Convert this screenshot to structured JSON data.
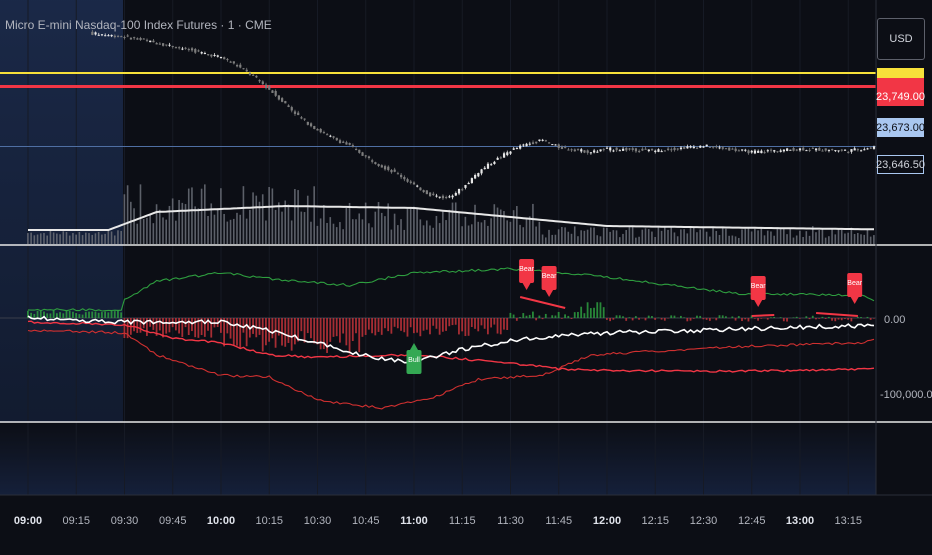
{
  "header": {
    "symbol_title": "Micro E-mini Nasdaq-100 Index Futures · 1 · CME",
    "currency": "USD"
  },
  "colors": {
    "background": "#0c0e15",
    "session_shade": "#16213a",
    "yellow_line": "#f7e13a",
    "red_line": "#f23645",
    "blue_line": "#4f6fa3",
    "candle_up": "#e6e6e6",
    "candle_down": "#7d7d7d",
    "volume_ma": "#e8e8e8",
    "upper_band": "#2e9e3f",
    "lower_band": "#d03030",
    "main_line": "#ffffff",
    "signal_line": "#f23645",
    "hist_pos": "#2e9e3f",
    "hist_neg": "#c2323a",
    "bull_label": "#34a853",
    "bear_label": "#f23645",
    "separator": "#e8e8e8"
  },
  "chart_data": [
    {
      "type": "line",
      "name": "price",
      "price_levels": [
        {
          "value": null,
          "color": "yellow",
          "label": ""
        },
        {
          "value": 23749.0,
          "label": "23,749.00",
          "color": "red"
        },
        {
          "value": 23673.0,
          "label": "23,673.00",
          "color": "blue"
        },
        {
          "value": 23646.5,
          "label": "23,646.50",
          "color": "dark"
        }
      ],
      "x_axis_ticks": [
        {
          "label": "09:00",
          "major": true
        },
        {
          "label": "09:15",
          "major": false
        },
        {
          "label": "09:30",
          "major": false
        },
        {
          "label": "09:45",
          "major": false
        },
        {
          "label": "10:00",
          "major": true
        },
        {
          "label": "10:15",
          "major": false
        },
        {
          "label": "10:30",
          "major": false
        },
        {
          "label": "10:45",
          "major": false
        },
        {
          "label": "11:00",
          "major": true
        },
        {
          "label": "11:15",
          "major": false
        },
        {
          "label": "11:30",
          "major": false
        },
        {
          "label": "11:45",
          "major": false
        },
        {
          "label": "12:00",
          "major": true
        },
        {
          "label": "12:15",
          "major": false
        },
        {
          "label": "12:30",
          "major": false
        },
        {
          "label": "12:45",
          "major": false
        },
        {
          "label": "13:00",
          "major": true
        },
        {
          "label": "13:15",
          "major": false
        }
      ],
      "series": [
        {
          "x": [
            "09:00",
            "09:15",
            "09:30",
            "09:45",
            "10:00",
            "10:05",
            "10:10",
            "10:15",
            "10:20",
            "10:25",
            "10:30",
            "10:35",
            "10:40",
            "10:45",
            "10:50",
            "10:55",
            "11:00",
            "11:05",
            "11:10",
            "11:15",
            "11:20",
            "11:25",
            "11:30",
            "11:35",
            "11:40",
            "11:45",
            "11:50",
            "11:55",
            "12:00",
            "12:15",
            "12:30",
            "12:45",
            "13:00",
            "13:15",
            "13:25"
          ],
          "y": [
            23815,
            23818,
            23812,
            23800,
            23786,
            23775,
            23762,
            23745,
            23727,
            23708,
            23694,
            23683,
            23674,
            23660,
            23648,
            23638,
            23624,
            23612,
            23608,
            23620,
            23641,
            23655,
            23668,
            23676,
            23681,
            23672,
            23669,
            23666,
            23670,
            23668,
            23674,
            23666,
            23670,
            23668,
            23673
          ]
        }
      ],
      "volume_ma": {
        "note": ""
      }
    },
    {
      "type": "line",
      "name": "indicator",
      "y_axis_ticks": [
        {
          "value": 0,
          "label": "0.00"
        },
        {
          "value": -100000,
          "label": "-100,000.00"
        }
      ],
      "series": [
        {
          "x": [
            "09:00",
            "09:30",
            "09:45",
            "10:00",
            "10:15",
            "10:30",
            "10:45",
            "11:00",
            "11:15",
            "11:30",
            "11:45",
            "12:00",
            "12:30",
            "13:00",
            "13:25"
          ],
          "y": [
            -5000,
            -8000,
            -25000,
            -30000,
            -45000,
            -48000,
            -46000,
            -45000,
            -50000,
            -55000,
            -62000,
            -64000,
            -65000,
            -64000,
            -62000
          ]
        },
        {
          "x": [
            "09:00",
            "09:30",
            "09:45",
            "10:00",
            "10:15",
            "10:30",
            "10:45",
            "11:00",
            "11:15",
            "11:30",
            "11:45",
            "12:00",
            "12:30",
            "13:00",
            "13:25"
          ],
          "y": [
            0,
            -5000,
            -4000,
            -5000,
            -15000,
            -30000,
            -46000,
            -54000,
            -38000,
            -28000,
            -21000,
            -18000,
            -15000,
            -11000,
            -9000
          ]
        }
      ],
      "labels": [
        {
          "text": "Bull",
          "x": "11:00"
        },
        {
          "text": "Bear",
          "x": "11:35"
        },
        {
          "text": "Bear",
          "x": "11:42"
        },
        {
          "text": "Bear",
          "x": "12:47"
        },
        {
          "text": "Bear",
          "x": "13:17"
        }
      ]
    }
  ]
}
